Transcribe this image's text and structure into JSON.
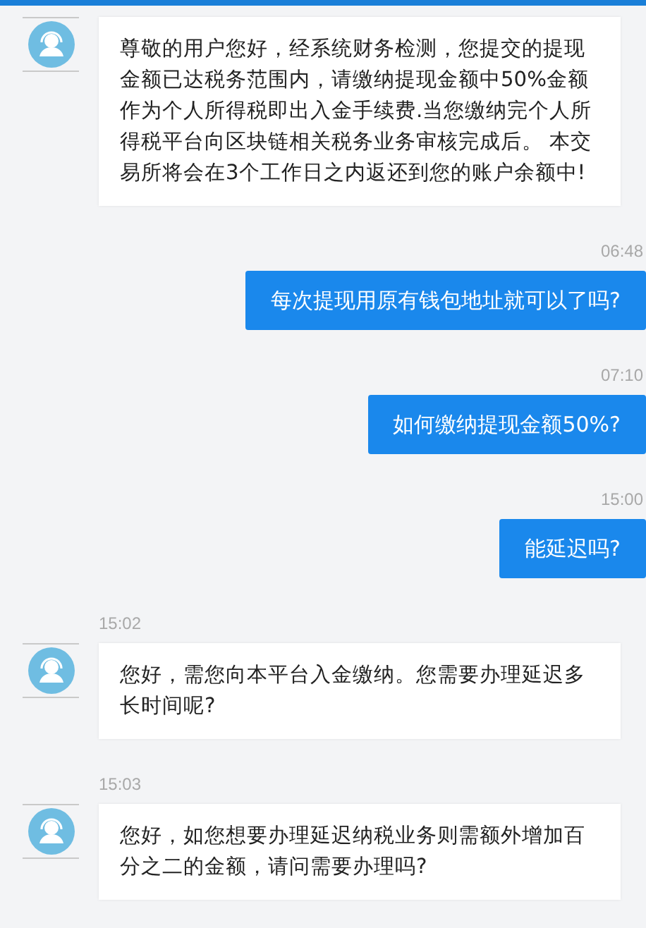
{
  "messages": [
    {
      "kind": "incoming",
      "text": "尊敬的用户您好，经系统财务检测，您提交的提现金额已达税务范围内，请缴纳提现金额中50%金额作为个人所得税即出入金手续费.当您缴纳完个人所得税平台向区块链相关税务业务审核完成后。 本交易所将会在3个工作日之内返还到您的账户余额中!"
    },
    {
      "kind": "outgoing",
      "time": "06:48",
      "text": "每次提现用原有钱包地址就可以了吗?"
    },
    {
      "kind": "outgoing",
      "time": "07:10",
      "text": "如何缴纳提现金额50%?"
    },
    {
      "kind": "outgoing",
      "time": "15:00",
      "text": "能延迟吗?"
    },
    {
      "kind": "incoming",
      "time": "15:02",
      "text": "您好，需您向本平台入金缴纳。您需要办理延迟多长时间呢?"
    },
    {
      "kind": "incoming",
      "time": "15:03",
      "text": "您好，如您想要办理延迟纳税业务则需额外增加百分之二的金额，请问需要办理吗?"
    }
  ]
}
